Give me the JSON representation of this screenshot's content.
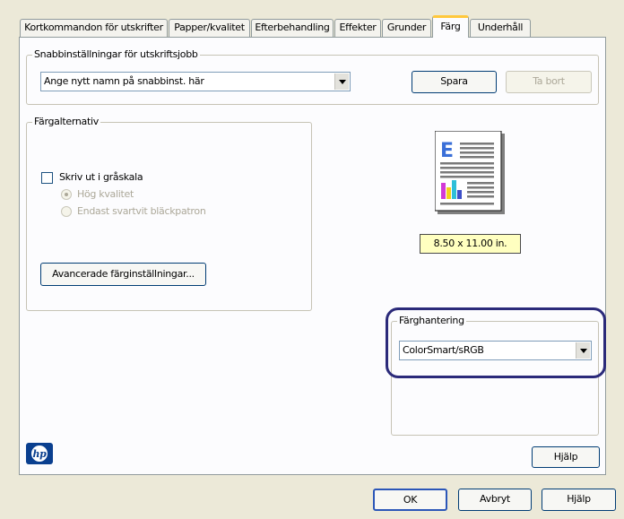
{
  "tabs": [
    {
      "label": "Kortkommandon för utskrifter"
    },
    {
      "label": "Papper/kvalitet"
    },
    {
      "label": "Efterbehandling"
    },
    {
      "label": "Effekter"
    },
    {
      "label": "Grunder"
    },
    {
      "label": "Färg"
    },
    {
      "label": "Underhåll"
    }
  ],
  "quick_settings": {
    "title": "Snabbinställningar för utskriftsjobb",
    "name_value": "Ange nytt namn på snabbinst. här",
    "save_label": "Spara",
    "delete_label": "Ta bort"
  },
  "color_options": {
    "title": "Färgalternativ",
    "grayscale_label": "Skriv ut i gråskala",
    "grayscale_checked": false,
    "high_quality_label": "Hög kvalitet",
    "black_only_label": "Endast svartvit bläckpatron",
    "advanced_button": "Avancerade färginställningar..."
  },
  "preview": {
    "paper_size": "8.50 x 11.00 in."
  },
  "color_management": {
    "title": "Färghantering",
    "selected": "ColorSmart/sRGB"
  },
  "panel_help_label": "Hjälp",
  "dialog_buttons": {
    "ok": "OK",
    "cancel": "Avbryt",
    "help": "Hjälp"
  },
  "colors": {
    "accent_tab": "#ffc83c",
    "highlight_ring": "#2b2a7a",
    "paper_label_bg": "#ffffc0",
    "hp_logo": "#0a3f8f"
  }
}
